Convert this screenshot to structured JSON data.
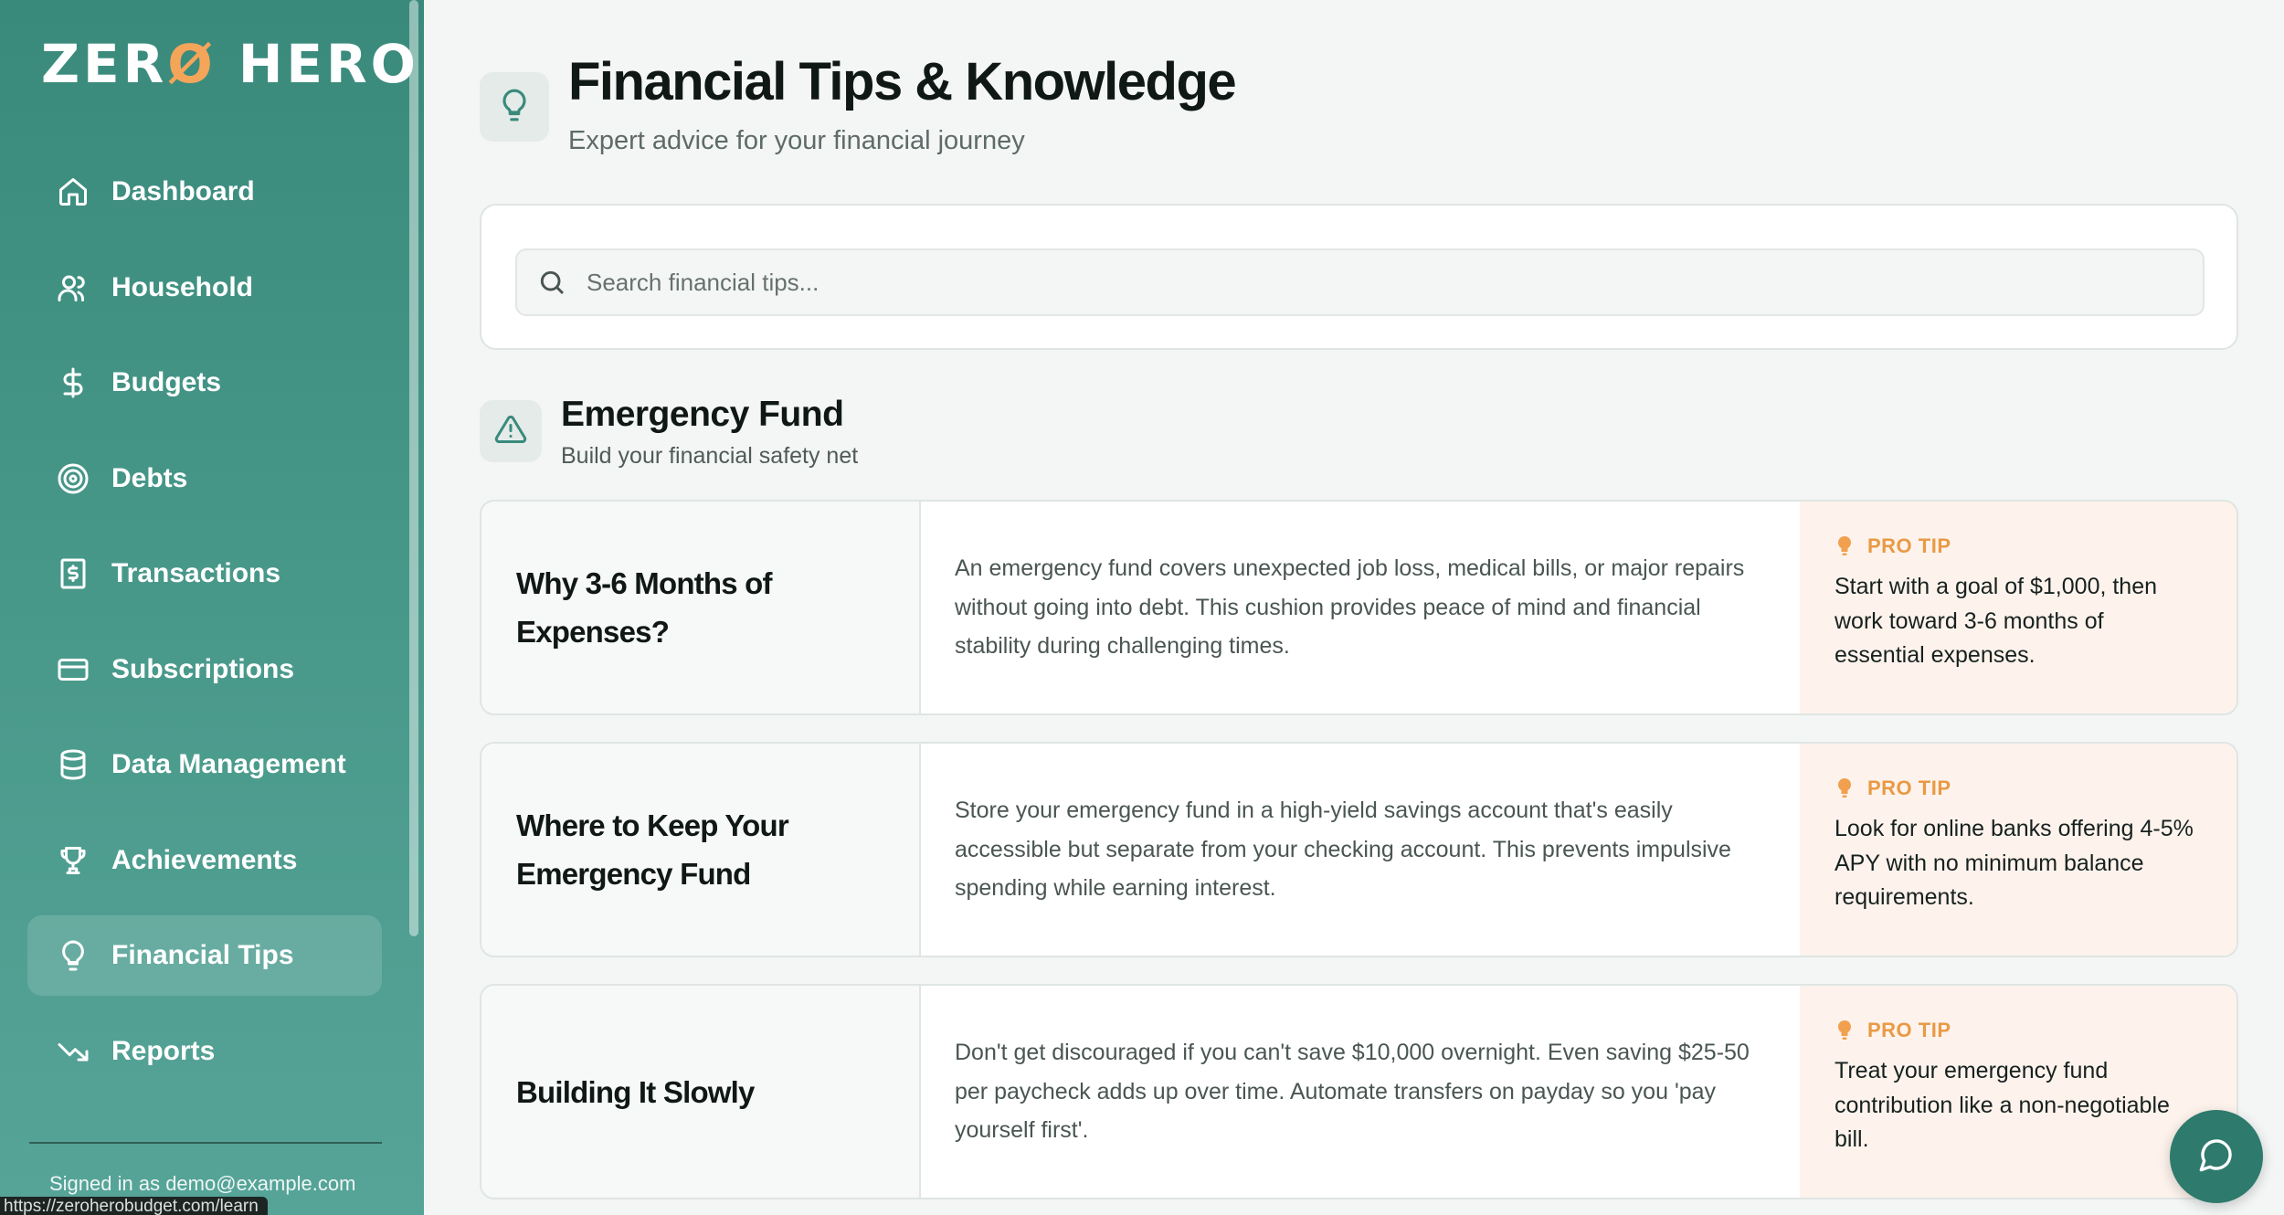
{
  "app": {
    "logo_left": "ZER",
    "logo_accent": "Ø",
    "logo_right": " HERO",
    "accent_color": "#f5a55a",
    "brand_color": "#3a8a7c"
  },
  "sidebar": {
    "items": [
      {
        "label": "Dashboard",
        "icon": "home-icon"
      },
      {
        "label": "Household",
        "icon": "users-icon"
      },
      {
        "label": "Budgets",
        "icon": "dollar-icon"
      },
      {
        "label": "Debts",
        "icon": "target-icon"
      },
      {
        "label": "Transactions",
        "icon": "receipt-icon"
      },
      {
        "label": "Subscriptions",
        "icon": "credit-card-icon"
      },
      {
        "label": "Data Management",
        "icon": "database-icon"
      },
      {
        "label": "Achievements",
        "icon": "trophy-icon"
      },
      {
        "label": "Financial Tips",
        "icon": "lightbulb-icon",
        "active": true
      },
      {
        "label": "Reports",
        "icon": "trending-down-icon"
      }
    ],
    "signed_in": "Signed in as demo@example.com",
    "status_url": "https://zeroherobudget.com/learn"
  },
  "header": {
    "title": "Financial Tips & Knowledge",
    "subtitle": "Expert advice for your financial journey"
  },
  "search": {
    "placeholder": "Search financial tips...",
    "value": ""
  },
  "section": {
    "title": "Emergency Fund",
    "subtitle": "Build your financial safety net"
  },
  "tips": [
    {
      "title": "Why 3-6 Months of Expenses?",
      "body": "An emergency fund covers unexpected job loss, medical bills, or major repairs without going into debt. This cushion provides peace of mind and financial stability during challenging times.",
      "pro_label": "PRO TIP",
      "pro_text": "Start with a goal of $1,000, then work toward 3-6 months of essential expenses."
    },
    {
      "title": "Where to Keep Your Emergency Fund",
      "body": "Store your emergency fund in a high-yield savings account that's easily accessible but separate from your checking account. This prevents impulsive spending while earning interest.",
      "pro_label": "PRO TIP",
      "pro_text": "Look for online banks offering 4-5% APY with no minimum balance requirements."
    },
    {
      "title": "Building It Slowly",
      "body": "Don't get discouraged if you can't save $10,000 overnight. Even saving $25-50 per paycheck adds up over time. Automate transfers on payday so you 'pay yourself first'.",
      "pro_label": "PRO TIP",
      "pro_text": "Treat your emergency fund contribution like a non-negotiable bill."
    }
  ]
}
